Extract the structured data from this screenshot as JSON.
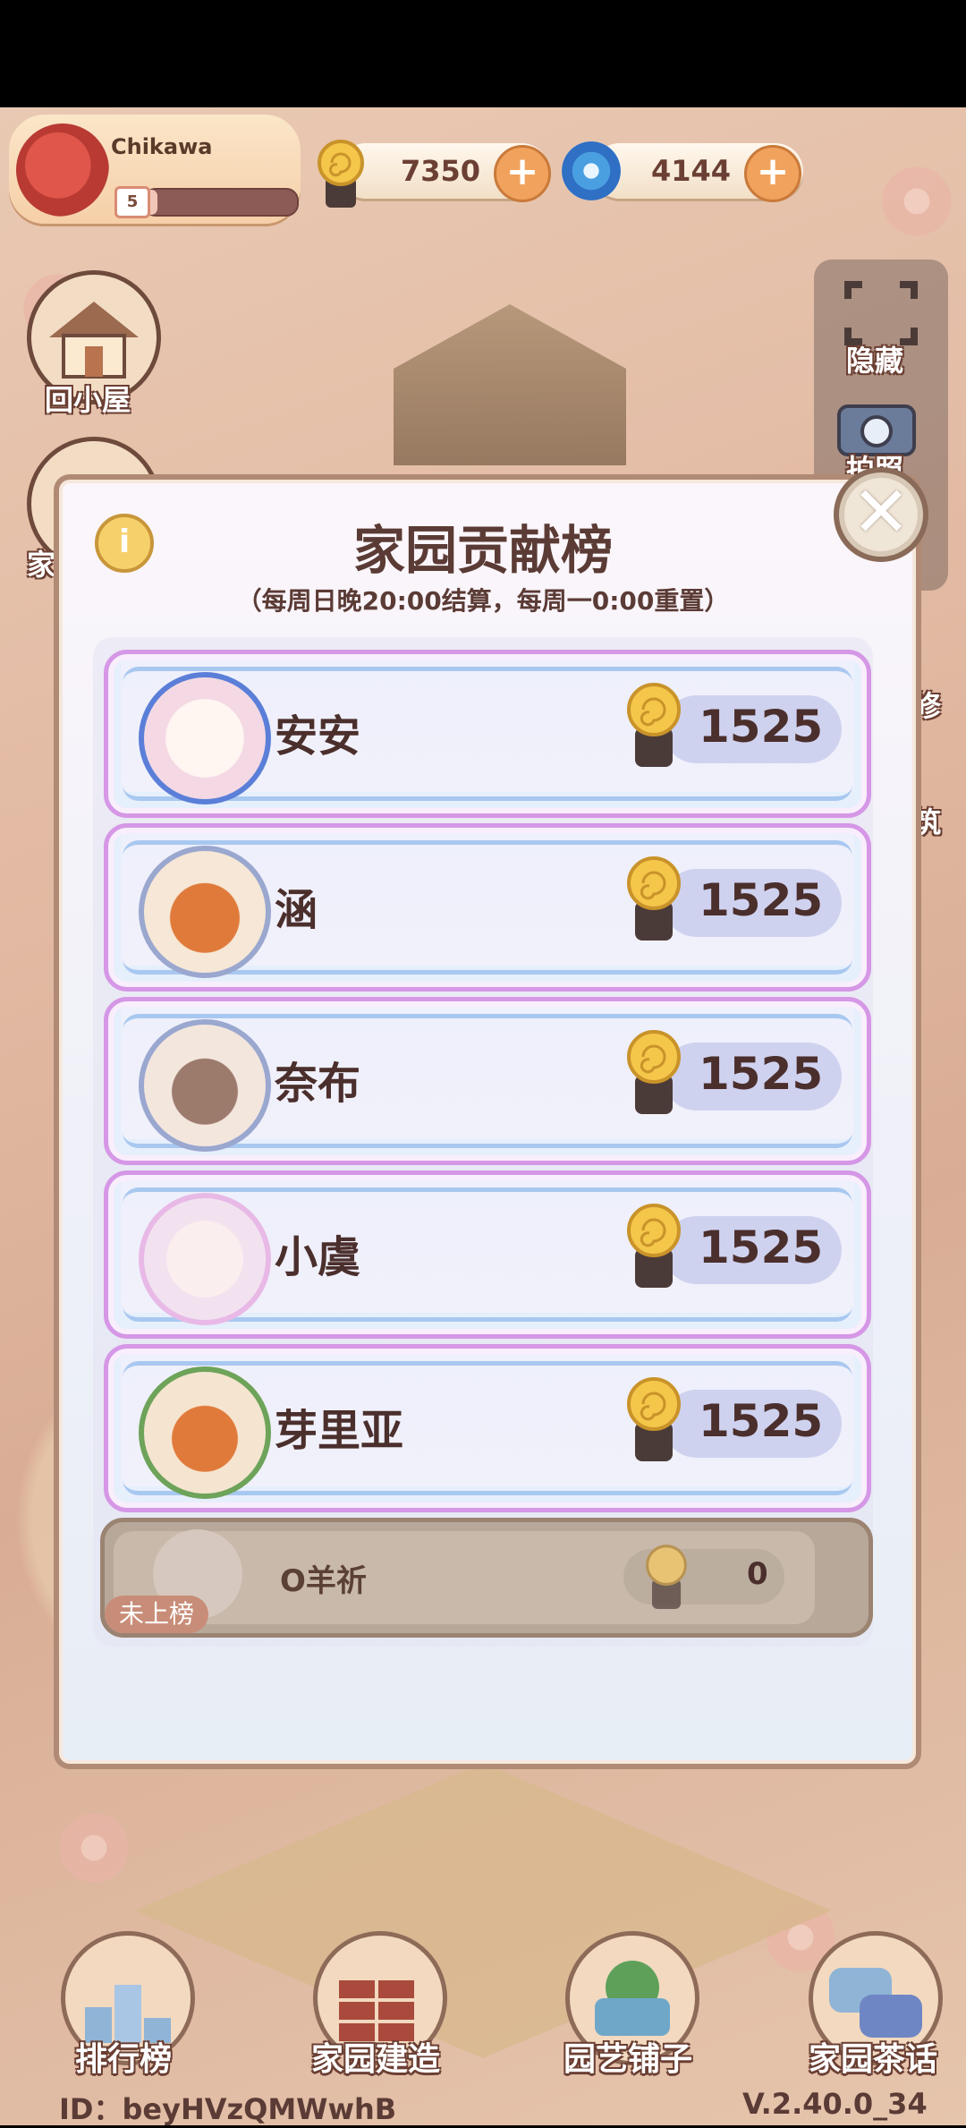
{
  "player": {
    "name": "Chikawa",
    "level": "5",
    "xp_fraction": 0.08
  },
  "currencies": [
    {
      "name": "snail-coin",
      "value": "7350",
      "plus": "+"
    },
    {
      "name": "spiral-gem",
      "value": "4144",
      "plus": "+"
    }
  ],
  "side_left": [
    {
      "label": "回小屋"
    },
    {
      "label": "家"
    }
  ],
  "side_right": [
    {
      "label": "隐藏"
    },
    {
      "label": "拍照"
    },
    {
      "label": "修"
    },
    {
      "label": "筑"
    }
  ],
  "modal": {
    "title": "家园贡献榜",
    "subtitle": "（每周日晚20:00结算，每周一0:00重置）",
    "info": "i",
    "close": "✕",
    "rows": [
      {
        "name": "安安",
        "score": "1525"
      },
      {
        "name": "涵",
        "score": "1525"
      },
      {
        "name": "奈布",
        "score": "1525"
      },
      {
        "name": "小虞",
        "score": "1525"
      },
      {
        "name": "芽里亚",
        "score": "1525"
      }
    ],
    "self": {
      "name": "O羊祈",
      "score": "0",
      "tag": "未上榜"
    }
  },
  "bottom_nav": [
    {
      "label": "排行榜"
    },
    {
      "label": "家园建造"
    },
    {
      "label": "园艺铺子"
    },
    {
      "label": "家园茶话"
    }
  ],
  "footer": {
    "id": "ID：beyHVzQMWwhB",
    "version": "V.2.40.0_34"
  },
  "colors": {
    "accent": "#d597e6",
    "title": "#5b3b35",
    "coin": "#f1a35d"
  }
}
